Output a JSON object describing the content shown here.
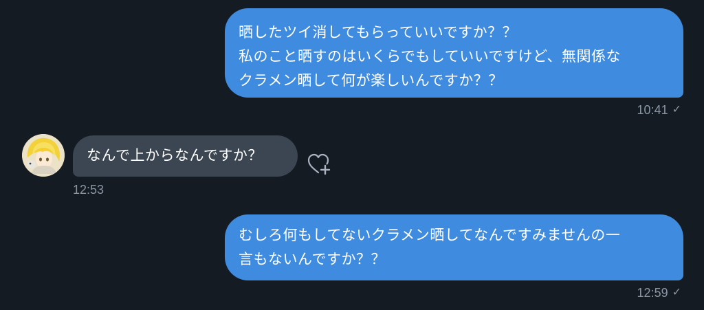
{
  "messages": [
    {
      "direction": "sent",
      "lines": [
        "晒したツイ消してもらっていいですか？？",
        "私のこと晒すのはいくらでもしていいですけど、無関係な",
        "クラメン晒して何が楽しいんですか？？"
      ],
      "time": "10:41",
      "status_icon": "check-icon"
    },
    {
      "direction": "received",
      "lines": [
        "なんで上からなんですか？"
      ],
      "time": "12:53",
      "avatar": "user-avatar",
      "reaction_icon": "heart-plus-icon"
    },
    {
      "direction": "sent",
      "lines": [
        "むしろ何もしてないクラメン晒してなんですみませんの一",
        "言もないんですか？？"
      ],
      "time": "12:59",
      "status_icon": "check-icon"
    }
  ],
  "colors": {
    "background": "#151b23",
    "sent_bubble": "#3e8be0",
    "received_bubble": "#3b4652",
    "meta_text": "#8a96a3"
  }
}
